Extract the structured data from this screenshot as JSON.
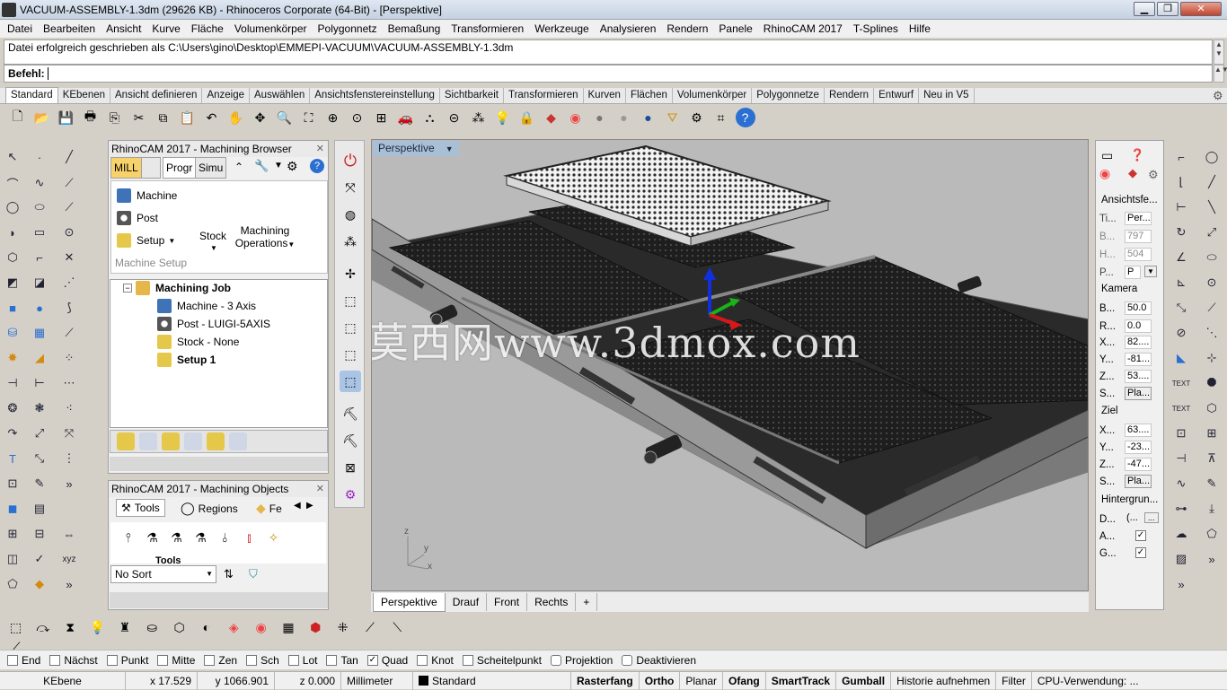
{
  "window": {
    "title": "VACUUM-ASSEMBLY-1.3dm (29626 KB) - Rhinoceros Corporate (64-Bit) - [Perspektive]",
    "min_label": "▁",
    "max_label": "❐",
    "close_label": "✕"
  },
  "menubar": [
    "Datei",
    "Bearbeiten",
    "Ansicht",
    "Kurve",
    "Fläche",
    "Volumenkörper",
    "Polygonnetz",
    "Bemaßung",
    "Transformieren",
    "Werkzeuge",
    "Analysieren",
    "Rendern",
    "Panele",
    "RhinoCAM 2017",
    "T-Splines",
    "Hilfe"
  ],
  "command": {
    "history": "Datei erfolgreich geschrieben als C:\\Users\\gino\\Desktop\\EMMEPI-VACUUM\\VACUUM-ASSEMBLY-1.3dm",
    "prompt_label": "Befehl:",
    "input_value": ""
  },
  "toolbar_tabs": [
    "Standard",
    "KEbenen",
    "Ansicht definieren",
    "Anzeige",
    "Auswählen",
    "Ansichtsfenstereinstellung",
    "Sichtbarkeit",
    "Transformieren",
    "Kurven",
    "Flächen",
    "Volumenkörper",
    "Polygonnetze",
    "Rendern",
    "Entwurf",
    "Neu in V5"
  ],
  "browser": {
    "title": "RhinoCAM 2017 - Machining Browser",
    "tab_mill": "MILL",
    "tab_prog": "Progr",
    "tab_simu": "Simu",
    "machine": "Machine",
    "post": "Post",
    "setup": "Setup",
    "stock": "Stock",
    "machining_ops_1": "Machining",
    "machining_ops_2": "Operations",
    "group_label": "Machine Setup",
    "tree": {
      "root": "Machining Job",
      "machine": "Machine - 3 Axis",
      "post": "Post - LUIGI-5AXIS",
      "stock": "Stock - None",
      "setup": "Setup 1"
    }
  },
  "objects": {
    "title": "RhinoCAM 2017 - Machining Objects",
    "tab_tools": "Tools",
    "tab_regions": "Regions",
    "tab_features": "Fe",
    "list_header": "Tools",
    "sort_value": "No Sort"
  },
  "viewport": {
    "title": "Perspektive",
    "watermark": "莫西网www.3dmox.com",
    "axis_z": "z",
    "axis_y": "y",
    "axis_x": "x"
  },
  "viewport_tabs": [
    "Perspektive",
    "Drauf",
    "Front",
    "Rechts",
    "+"
  ],
  "properties": {
    "section_view": "Ansichtsfe...",
    "rows_view": [
      {
        "label": "Ti...",
        "value": "Per..."
      },
      {
        "label": "B...",
        "value": "797"
      },
      {
        "label": "H...",
        "value": "504"
      },
      {
        "label": "P...",
        "value": "P"
      }
    ],
    "section_camera": "Kamera",
    "rows_camera": [
      {
        "label": "B...",
        "value": "50.0"
      },
      {
        "label": "R...",
        "value": "0.0"
      },
      {
        "label": "X...",
        "value": "82...."
      },
      {
        "label": "Y...",
        "value": "-81...."
      },
      {
        "label": "Z...",
        "value": "53...."
      },
      {
        "label": "S...",
        "value": "Pla..."
      }
    ],
    "section_target": "Ziel",
    "rows_target": [
      {
        "label": "X...",
        "value": "63...."
      },
      {
        "label": "Y...",
        "value": "-23...."
      },
      {
        "label": "Z...",
        "value": "-47...."
      },
      {
        "label": "S...",
        "value": "Pla..."
      }
    ],
    "section_bg": "Hintergrun...",
    "rows_bg": [
      {
        "label": "D...",
        "value": "(..."
      },
      {
        "label": "A...",
        "value": "✓"
      },
      {
        "label": "G...",
        "value": "✓"
      }
    ]
  },
  "right_text_1": "TEXT",
  "right_text_2": "TEXT",
  "osnaps": [
    {
      "label": "End",
      "checked": false
    },
    {
      "label": "Nächst",
      "checked": false
    },
    {
      "label": "Punkt",
      "checked": false
    },
    {
      "label": "Mitte",
      "checked": false
    },
    {
      "label": "Zen",
      "checked": false
    },
    {
      "label": "Sch",
      "checked": false
    },
    {
      "label": "Lot",
      "checked": false
    },
    {
      "label": "Tan",
      "checked": false
    },
    {
      "label": "Quad",
      "checked": true
    },
    {
      "label": "Knot",
      "checked": false
    },
    {
      "label": "Scheitelpunkt",
      "checked": false
    },
    {
      "label": "Projektion",
      "checked": false
    },
    {
      "label": "Deaktivieren",
      "checked": false
    }
  ],
  "status": {
    "layer_group": "KEbene",
    "x": "x 17.529",
    "y": "y 1066.901",
    "z": "z 0.000",
    "units": "Millimeter",
    "layer": "Standard",
    "rasterfang": "Rasterfang",
    "ortho": "Ortho",
    "planar": "Planar",
    "ofang": "Ofang",
    "smarttrack": "SmartTrack",
    "gumball": "Gumball",
    "history": "Historie aufnehmen",
    "filter": "Filter",
    "cpu": "CPU-Verwendung: ..."
  },
  "colors": {
    "accent_blue": "#2a6fd1",
    "mill_tab": "#f7d26a",
    "viewport_bg": "#bababa"
  }
}
